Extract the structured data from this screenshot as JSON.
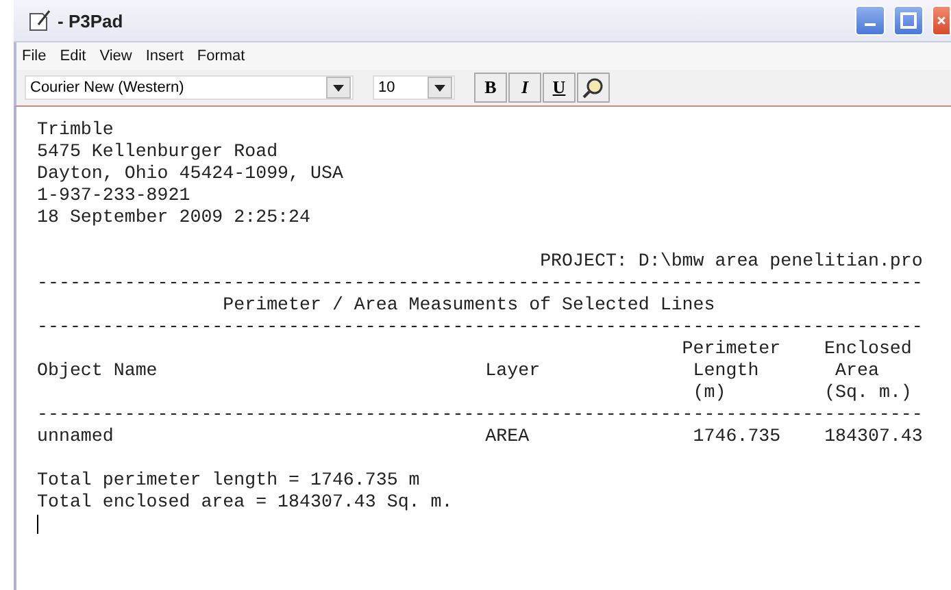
{
  "window": {
    "title": "- P3Pad",
    "controls": [
      {
        "kind": "minimize"
      },
      {
        "kind": "maximize"
      },
      {
        "kind": "close"
      }
    ]
  },
  "menu": [
    {
      "label": "File"
    },
    {
      "label": "Edit"
    },
    {
      "label": "View"
    },
    {
      "label": "Insert"
    },
    {
      "label": "Format"
    }
  ],
  "toolbar": {
    "font": "Courier New (Western)",
    "size": "10",
    "buttons": [
      {
        "kind": "bold",
        "label": "B"
      },
      {
        "kind": "italic",
        "label": "I"
      },
      {
        "kind": "underline",
        "label": "U"
      },
      {
        "kind": "find"
      }
    ]
  },
  "document": {
    "blocks": [
      {
        "lines": [
          "Trimble",
          "5475 Kellenburger Road",
          "Dayton, Ohio 45424-1099, USA",
          "1-937-233-8921",
          "18 September 2009 2:25:24"
        ]
      },
      {
        "lines": [
          "                                              PROJECT: D:\\bmw area penelitian.pro",
          "---------------------------------------------------------------------------------",
          "                 Perimeter / Area Measuments of Selected Lines",
          "---------------------------------------------------------------------------------",
          "                                                           Perimeter    Enclosed",
          "Object Name                              Layer              Length       Area",
          "                                                            (m)         (Sq. m.)",
          "---------------------------------------------------------------------------------",
          "unnamed                                  AREA               1746.735    184307.43"
        ]
      },
      {
        "lines": [
          "Total perimeter length = 1746.735 m",
          "Total enclosed area = 184307.43 Sq. m."
        ]
      }
    ],
    "cursor": true
  }
}
